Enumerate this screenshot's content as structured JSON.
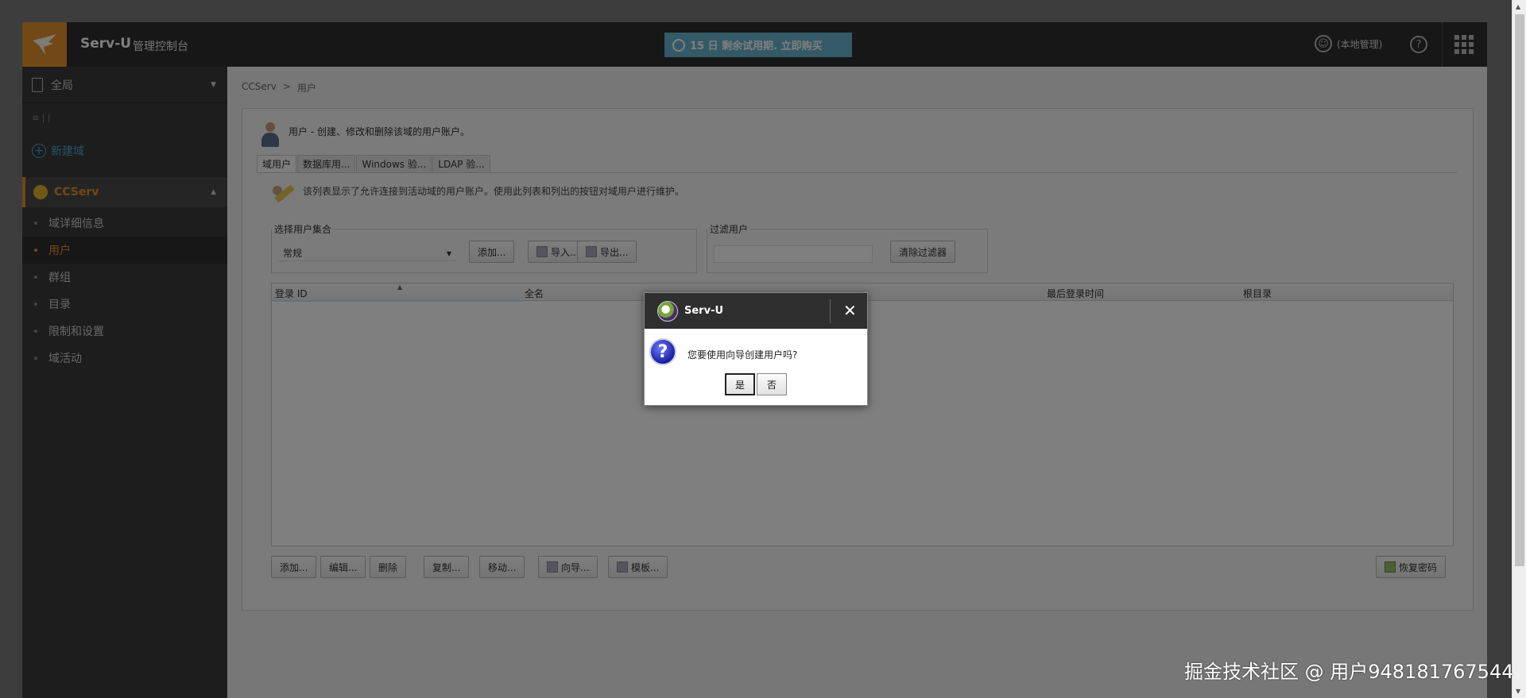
{
  "header": {
    "brand": "Serv-U",
    "subtitle": "管理控制台",
    "trial": "15 日 剩余试用期. 立即购买",
    "user": "(本地管理)",
    "help": "?"
  },
  "sidebar": {
    "global": "全局",
    "small_row": "≡ | |",
    "new_domain": "新建域",
    "domain": "CCServ",
    "items": [
      {
        "label": "域详细信息"
      },
      {
        "label": "用户"
      },
      {
        "label": "群组"
      },
      {
        "label": "目录"
      },
      {
        "label": "限制和设置"
      },
      {
        "label": "域活动"
      }
    ]
  },
  "breadcrumb": [
    "CCServ",
    ">",
    "用户"
  ],
  "panel": {
    "description": "用户 - 创建、修改和删除该域的用户账户。",
    "tabs": [
      "域用户",
      "数据库用...",
      "Windows 验...",
      "LDAP 验..."
    ],
    "info": "该列表显示了允许连接到活动域的用户账户。使用此列表和列出的按钮对域用户进行维护。",
    "user_set_legend": "选择用户集合",
    "user_set_value": "常规",
    "add_label": "添加...",
    "import_label": "导入...",
    "export_label": "导出...",
    "filter_legend": "过滤用户",
    "clear_filter_label": "清除过滤器",
    "columns": [
      "登录 ID",
      "全名",
      "最后登录时间",
      "根目录"
    ],
    "bottom_buttons": {
      "add": "添加...",
      "edit": "编辑...",
      "delete": "删除",
      "copy": "复制...",
      "move": "移动...",
      "wizard": "向导...",
      "template": "模板...",
      "recover_password": "恢复密码"
    }
  },
  "dialog": {
    "title": "Serv-U",
    "close": "✕",
    "message": "您要使用向导创建用户吗?",
    "yes": "是",
    "no": "否"
  },
  "watermark": "掘金技术社区 @ 用户948181767544"
}
